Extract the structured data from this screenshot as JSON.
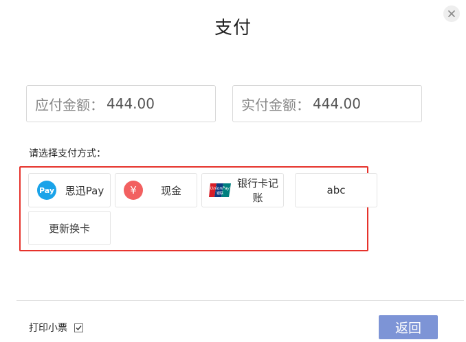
{
  "dialog": {
    "title": "支付",
    "close_icon": "close-icon"
  },
  "amounts": {
    "payable_label": "应付金额：",
    "payable_value": "444.00",
    "actual_label": "实付金额：",
    "actual_value": "444.00"
  },
  "payment": {
    "section_label": "请选择支付方式：",
    "highlight_color": "#e6322b",
    "methods": [
      {
        "label": "思迅Pay",
        "icon": "sixun-pay-icon",
        "icon_color": "#1aa3e9"
      },
      {
        "label": "现金",
        "icon": "yuan-icon",
        "icon_color": "#f26060"
      },
      {
        "label": "银行卡记账",
        "icon": "unionpay-icon",
        "icon_color": "#d71e28"
      },
      {
        "label": "abc",
        "icon": "",
        "icon_color": ""
      },
      {
        "label": "更新换卡",
        "icon": "",
        "icon_color": ""
      }
    ]
  },
  "footer": {
    "print_label": "打印小票",
    "print_checked": true,
    "back_label": "返回",
    "back_color": "#7d94d6"
  }
}
